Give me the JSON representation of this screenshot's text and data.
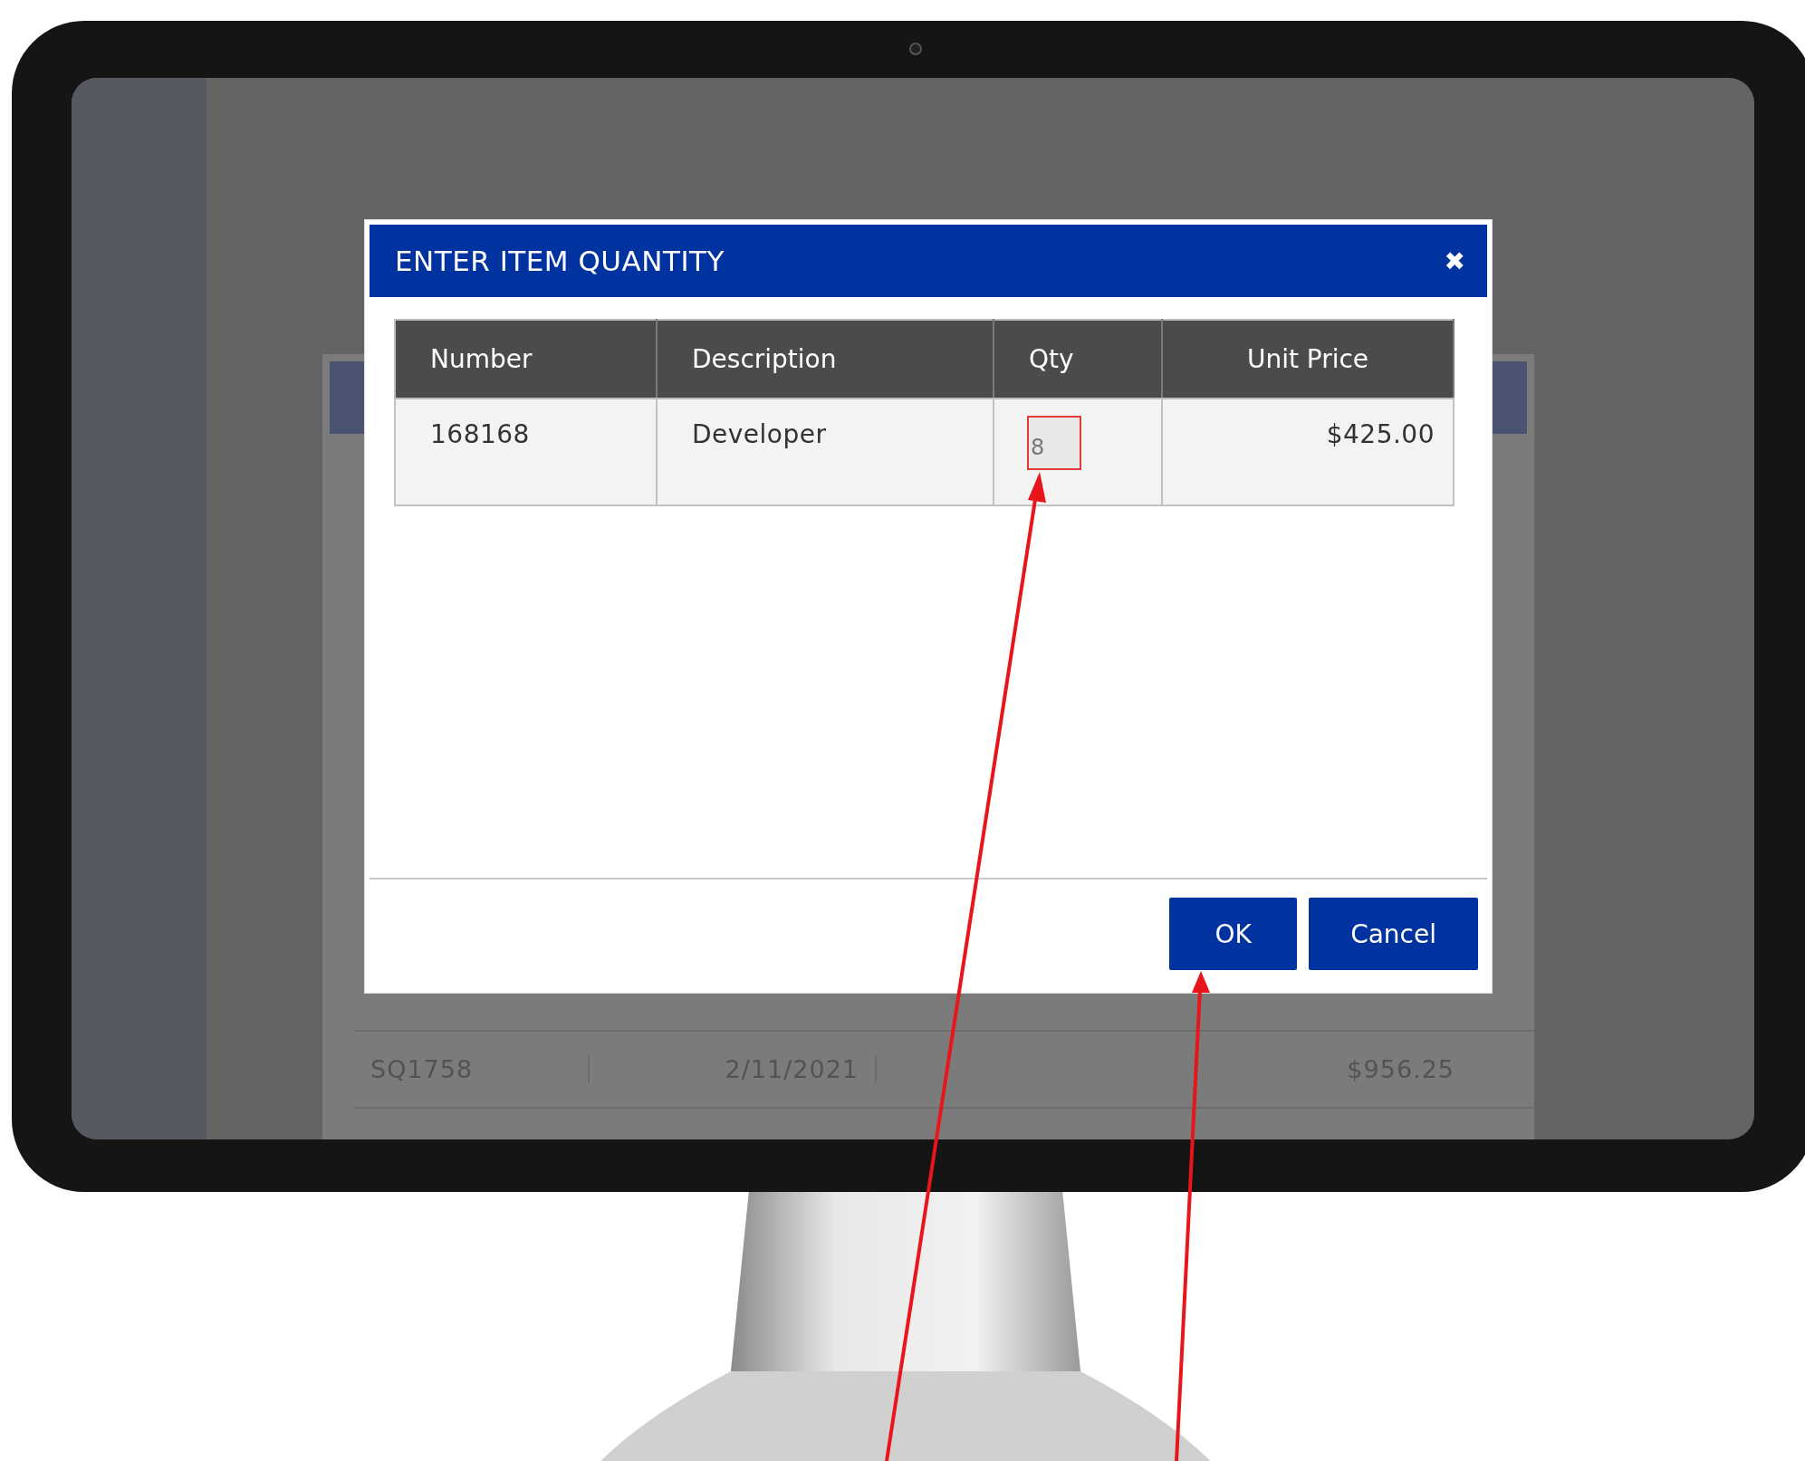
{
  "dialog": {
    "title": "ENTER ITEM QUANTITY",
    "close": "✖",
    "columns": [
      "Number",
      "Description",
      "Qty",
      "Unit Price"
    ],
    "rows": [
      {
        "number": "168168",
        "description": "Developer",
        "qty": "8",
        "unit_price": "$425.00"
      }
    ],
    "buttons": [
      "OK",
      "Cancel"
    ]
  },
  "background_table": {
    "rows": [
      {
        "number": "SQ1758",
        "date": "2/11/2021",
        "amount": "$956.25"
      }
    ]
  }
}
